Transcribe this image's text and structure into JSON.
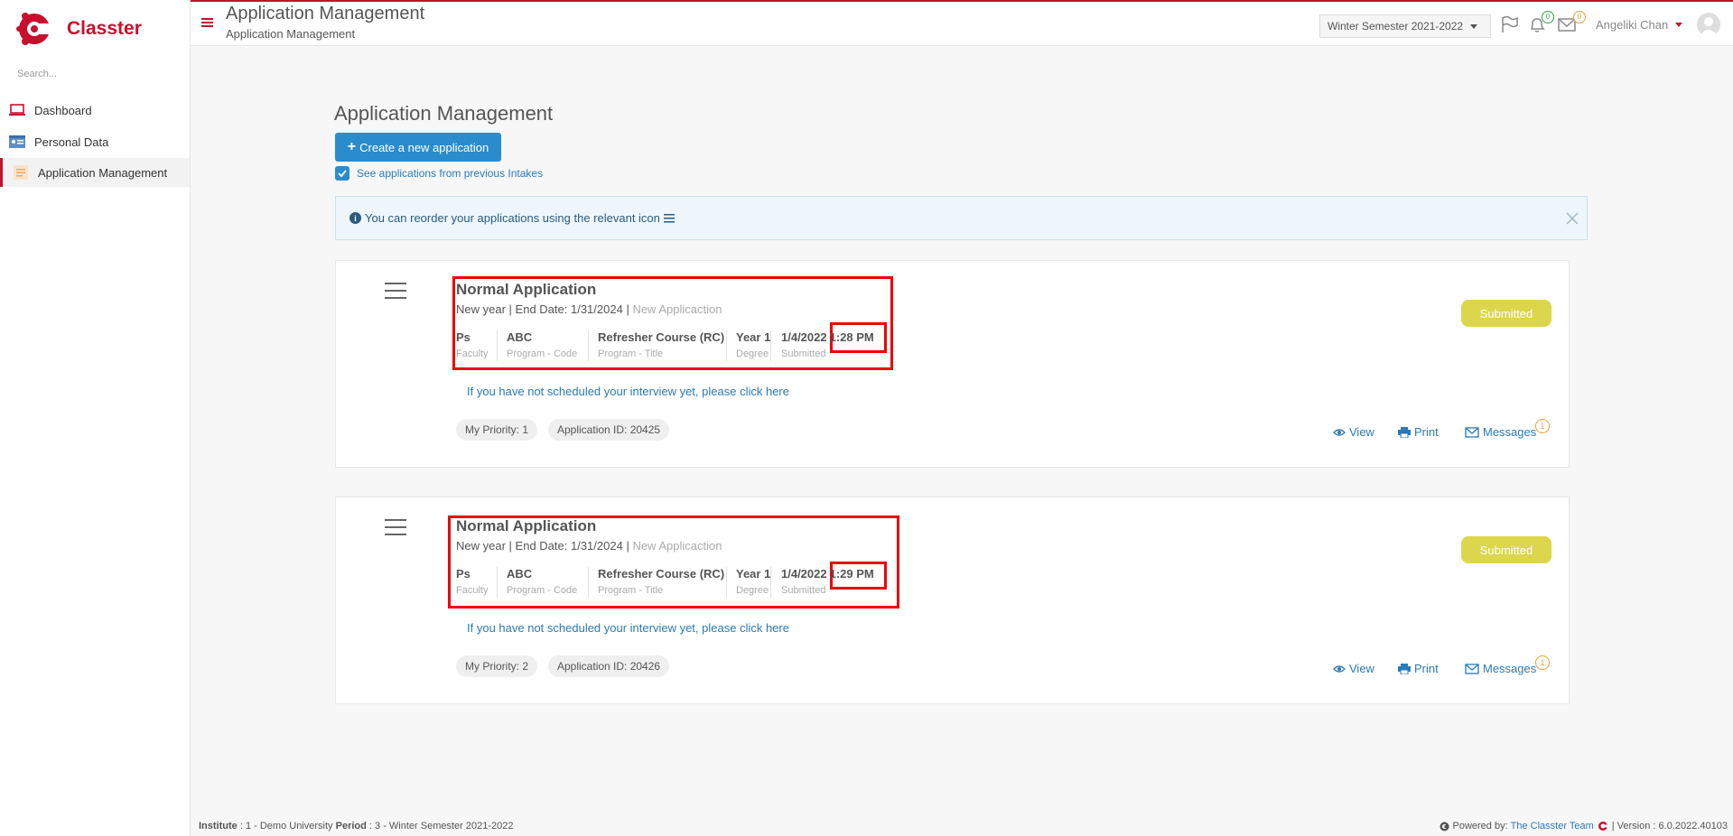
{
  "brand": {
    "name": "Classter",
    "accent": "#c8102e",
    "link_color": "#2a7ab8"
  },
  "sidebar": {
    "search_placeholder": "Search...",
    "items": [
      {
        "label": "Dashboard",
        "icon": "laptop-icon"
      },
      {
        "label": "Personal Data",
        "icon": "id-card-icon"
      },
      {
        "label": "Application Management",
        "icon": "document-icon",
        "active": true
      }
    ]
  },
  "header": {
    "title": "Application Management",
    "breadcrumb": "Application Management",
    "semester": "Winter Semester 2021-2022",
    "notifications_count": "0",
    "mail_count": "0",
    "user_name": "Angeliki Chan"
  },
  "main": {
    "title": "Application Management",
    "create_button": "Create a new application",
    "previous_intakes_label": "See applications from previous Intakes",
    "previous_intakes_checked": true,
    "info_text": "You can reorder your applications using the relevant icon",
    "applications": [
      {
        "title": "Normal Application",
        "year": "New year",
        "end_date": "End Date: 1/31/2024",
        "type": "New Applicaction",
        "faculty": "Ps",
        "faculty_label": "Faculty",
        "program_code": "ABC",
        "program_code_label": "Program - Code",
        "program_title": "Refresher Course (RC)",
        "program_title_label": "Program - Title",
        "degree": "Year 1",
        "degree_label": "Degree",
        "submitted_date": "1/4/2022",
        "submitted_time": "1:28 PM",
        "submitted_label": "Submitted",
        "interview_link": "If you have not scheduled your interview yet, please click here",
        "priority": "My Priority: 1",
        "application_id": "Application ID: 20425",
        "status": "Submitted",
        "view_label": "View",
        "print_label": "Print",
        "messages_label": "Messages",
        "messages_count": "1"
      },
      {
        "title": "Normal Application",
        "year": "New year",
        "end_date": "End Date: 1/31/2024",
        "type": "New Applicaction",
        "faculty": "Ps",
        "faculty_label": "Faculty",
        "program_code": "ABC",
        "program_code_label": "Program - Code",
        "program_title": "Refresher Course (RC)",
        "program_title_label": "Program - Title",
        "degree": "Year 1",
        "degree_label": "Degree",
        "submitted_date": "1/4/2022",
        "submitted_time": "1:29 PM",
        "submitted_label": "Submitted",
        "interview_link": "If you have not scheduled your interview yet, please click here",
        "priority": "My Priority: 2",
        "application_id": "Application ID: 20426",
        "status": "Submitted",
        "view_label": "View",
        "print_label": "Print",
        "messages_label": "Messages",
        "messages_count": "1"
      }
    ]
  },
  "footer": {
    "institute_label": "Institute",
    "institute_value": ": 1 - Demo University",
    "period_label": "Period",
    "period_value": ": 3 - Winter Semester 2021-2022",
    "powered_by": "Powered by:",
    "team_link": "The Classter Team",
    "version": "| Version : 6.0.2022.40103"
  }
}
